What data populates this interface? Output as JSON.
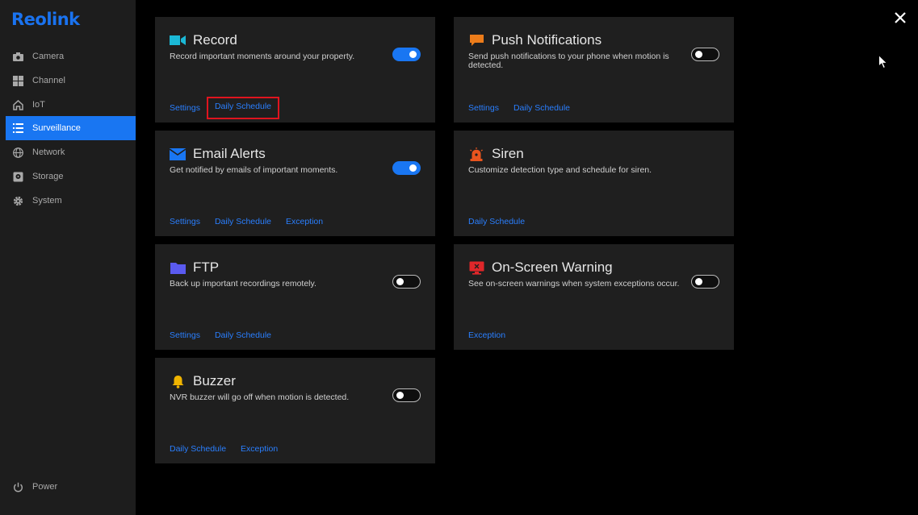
{
  "logo": "Reolink",
  "sidebar": {
    "items": [
      {
        "label": "Camera",
        "icon": "camera-icon"
      },
      {
        "label": "Channel",
        "icon": "grid-icon"
      },
      {
        "label": "IoT",
        "icon": "home-icon"
      },
      {
        "label": "Surveillance",
        "icon": "list-icon",
        "active": true
      },
      {
        "label": "Network",
        "icon": "globe-icon"
      },
      {
        "label": "Storage",
        "icon": "disk-icon"
      },
      {
        "label": "System",
        "icon": "gear-icon"
      }
    ],
    "power": "Power"
  },
  "cards": {
    "record": {
      "title": "Record",
      "desc": "Record important moments around your property.",
      "toggle": "on",
      "links": [
        "Settings",
        "Daily Schedule"
      ]
    },
    "email": {
      "title": "Email Alerts",
      "desc": "Get notified by emails of important moments.",
      "toggle": "on",
      "links": [
        "Settings",
        "Daily Schedule",
        "Exception"
      ]
    },
    "ftp": {
      "title": "FTP",
      "desc": "Back up important recordings remotely.",
      "toggle": "off",
      "links": [
        "Settings",
        "Daily Schedule"
      ]
    },
    "buzzer": {
      "title": "Buzzer",
      "desc": "NVR buzzer will go off when motion is detected.",
      "toggle": "off",
      "links": [
        "Daily Schedule",
        "Exception"
      ]
    },
    "push": {
      "title": "Push Notifications",
      "desc": "Send push notifications to your phone when motion is detected.",
      "toggle": "off",
      "links": [
        "Settings",
        "Daily Schedule"
      ]
    },
    "siren": {
      "title": "Siren",
      "desc": "Customize detection type and schedule for siren.",
      "links": [
        "Daily Schedule"
      ]
    },
    "onscreen": {
      "title": "On-Screen Warning",
      "desc": "See on-screen warnings when system exceptions occur.",
      "toggle": "off",
      "links": [
        "Exception"
      ]
    }
  },
  "colors": {
    "accent": "#1976f2",
    "link": "#2a7fff",
    "highlight": "#e0141e",
    "record_icon": "#1bb8d6",
    "email_icon": "#1976f2",
    "ftp_icon": "#5a5af0",
    "buzzer_icon": "#f0b400",
    "push_icon": "#ec7c1a",
    "siren_icon": "#e8541e",
    "onscreen_icon": "#e0272a"
  }
}
